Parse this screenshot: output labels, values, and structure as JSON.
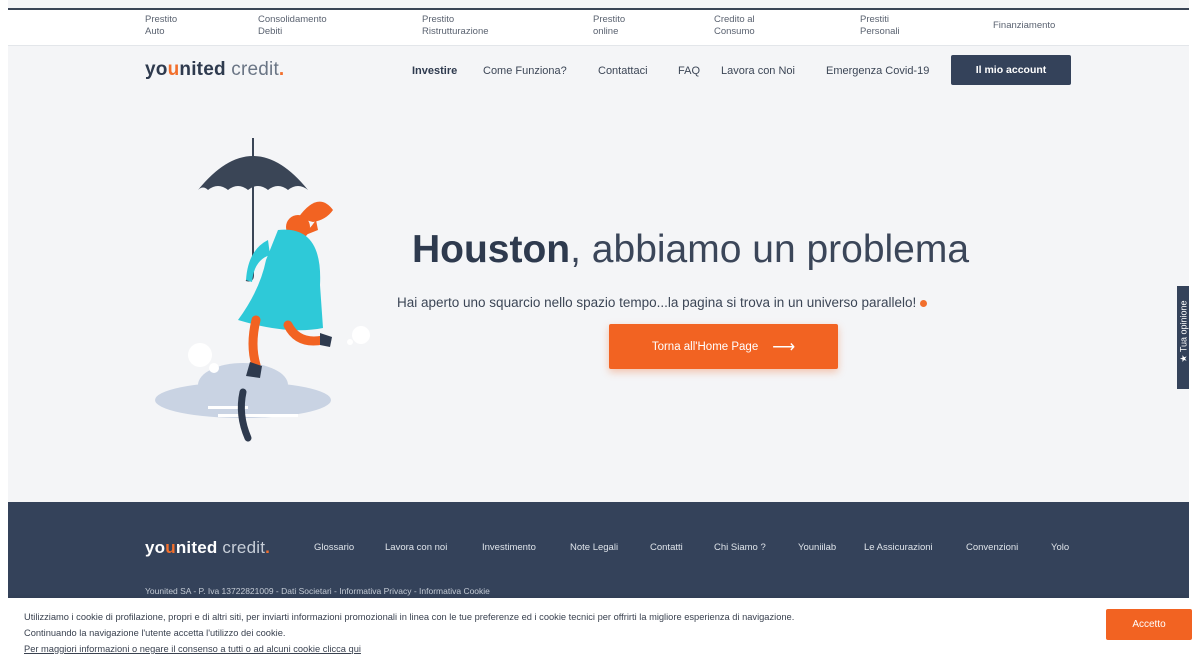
{
  "top_bar": {
    "products": [
      {
        "line1": "Prestito",
        "line2": "Auto"
      },
      {
        "line1": "Consolidamento",
        "line2": "Debiti"
      },
      {
        "line1": "Prestito",
        "line2": "Ristrutturazione"
      },
      {
        "line1": "Prestito",
        "line2": "online"
      },
      {
        "line1": "Credito al",
        "line2": "Consumo"
      },
      {
        "line1": "Prestiti",
        "line2": "Personali"
      },
      {
        "line1": "Finanziamento",
        "line2": ""
      }
    ]
  },
  "header": {
    "logo": {
      "you": "yo",
      "u": "u",
      "nited": "nited",
      "credit": " credit",
      "dot": "."
    },
    "nav": [
      {
        "label": "Investire"
      },
      {
        "label": "Come Funziona?"
      },
      {
        "label": "Contattaci"
      },
      {
        "label": "FAQ"
      },
      {
        "label": "Lavora con Noi"
      },
      {
        "label": "Emergenza Covid-19"
      }
    ],
    "account_button": "Il mio account"
  },
  "hero": {
    "title_bold": "Houston",
    "title_rest": ", abbiamo un problema",
    "subtitle": "Hai aperto uno squarcio nello spazio tempo...la pagina si trova in un universo parallelo!",
    "button_label": "Torna all'Home Page",
    "button_arrow": "⟶"
  },
  "feedback_tab": {
    "label": "★ Tua opinione"
  },
  "footer": {
    "logo": {
      "you": "yo",
      "u": "u",
      "nited": "nited",
      "credit": " credit",
      "dot": "."
    },
    "links": [
      "Glossario",
      "Lavora con noi",
      "Investimento",
      "Note Legali",
      "Contatti",
      "Chi Siamo ?",
      "Youniilab",
      "Le Assicurazioni",
      "Convenzioni",
      "Yolo"
    ],
    "legal": "Younited SA - P. Iva 13722821009 - Dati Societari - Informativa Privacy - Informativa Cookie"
  },
  "cookie_banner": {
    "line1": "Utilizziamo i cookie di profilazione, propri e di altri siti, per inviarti informazioni promozionali in linea con le tue preferenze ed i cookie tecnici per offrirti la migliore esperienza di navigazione.",
    "line2": "Continuando la navigazione l'utente accetta l'utilizzo dei cookie.",
    "link": "Per maggiori informazioni o negare il consenso a tutti o ad alcuni cookie clicca qui",
    "accept_button": "Accetto"
  },
  "colors": {
    "brand_orange": "#f26322",
    "navy": "#34425a",
    "background": "#f4f5f7"
  }
}
